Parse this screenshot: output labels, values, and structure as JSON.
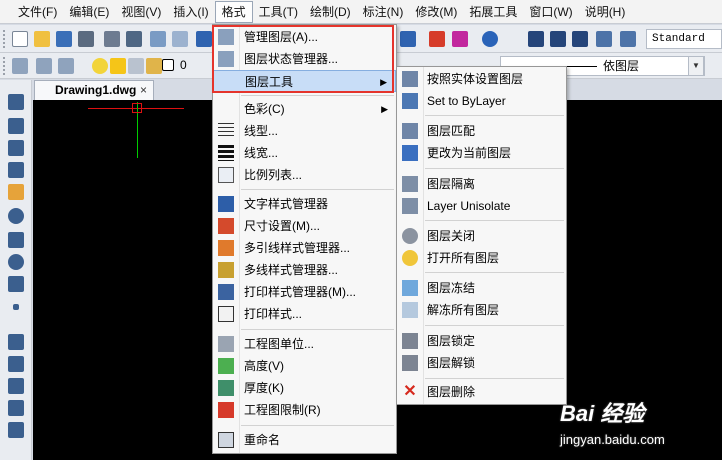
{
  "menubar": [
    "文件(F)",
    "编辑(E)",
    "视图(V)",
    "插入(I)",
    "格式",
    "工具(T)",
    "绘制(D)",
    "标注(N)",
    "修改(M)",
    "拓展工具",
    "窗口(W)",
    "说明(H)"
  ],
  "toolbar": {
    "text_style": "Standard",
    "layer_number": "0",
    "linetype": "依图层"
  },
  "document_tab": {
    "title": "Drawing1.dwg",
    "close": "×"
  },
  "format_menu": {
    "items": [
      {
        "label": "管理图层(A)...",
        "icon": "layer-manager-icon"
      },
      {
        "label": "图层状态管理器...",
        "icon": "layer-state-icon"
      },
      {
        "label": "图层工具",
        "icon": "",
        "submenu": true
      },
      {
        "label": "色彩(C)",
        "icon": "",
        "submenu": true
      },
      {
        "label": "线型...",
        "icon": "linetype-icon"
      },
      {
        "label": "线宽...",
        "icon": "lineweight-icon"
      },
      {
        "label": "比例列表...",
        "icon": "scale-list-icon"
      },
      {
        "label": "文字样式管理器",
        "icon": "text-style-icon"
      },
      {
        "label": "尺寸设置(M)...",
        "icon": "dim-style-icon"
      },
      {
        "label": "多引线样式管理器...",
        "icon": "mleader-style-icon"
      },
      {
        "label": "多线样式管理器...",
        "icon": "mline-style-icon"
      },
      {
        "label": "打印样式管理器(M)...",
        "icon": "plot-style-manager-icon"
      },
      {
        "label": "打印样式...",
        "icon": "plot-style-icon"
      },
      {
        "label": "工程图单位...",
        "icon": "units-icon"
      },
      {
        "label": "高度(V)",
        "icon": "elevation-icon"
      },
      {
        "label": "厚度(K)",
        "icon": "thickness-icon"
      },
      {
        "label": "工程图限制(R)",
        "icon": "limits-icon"
      },
      {
        "label": "重命名",
        "icon": "rename-icon"
      }
    ]
  },
  "layer_tools_submenu": {
    "items": [
      {
        "label": "按照实体设置图层",
        "icon": "layer-match-entity-icon"
      },
      {
        "label": "Set to ByLayer",
        "icon": "set-bylayer-icon"
      },
      {
        "label": "图层匹配",
        "icon": "layer-match-icon"
      },
      {
        "label": "更改为当前图层",
        "icon": "change-to-current-icon"
      },
      {
        "label": "图层隔离",
        "icon": "layer-isolate-icon"
      },
      {
        "label": "Layer Unisolate",
        "icon": "layer-unisolate-icon"
      },
      {
        "label": "图层关闭",
        "icon": "layer-off-icon"
      },
      {
        "label": "打开所有图层",
        "icon": "layer-on-all-icon"
      },
      {
        "label": "图层冻结",
        "icon": "layer-freeze-icon"
      },
      {
        "label": "解冻所有图层",
        "icon": "layer-thaw-all-icon"
      },
      {
        "label": "图层锁定",
        "icon": "layer-lock-icon"
      },
      {
        "label": "图层解锁",
        "icon": "layer-unlock-icon"
      },
      {
        "label": "图层删除",
        "icon": "layer-delete-icon"
      }
    ]
  },
  "watermark": {
    "brand": "Bai 经验",
    "url": "jingyan.baidu.com"
  },
  "colors": {
    "highlight": "#c8ddf7",
    "annotation": "#e5342c",
    "canvas": "#000000"
  }
}
